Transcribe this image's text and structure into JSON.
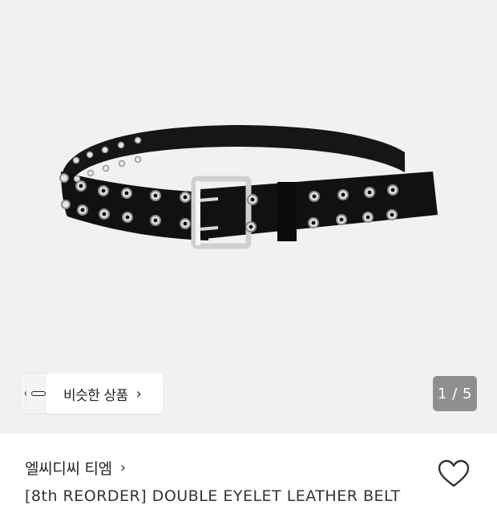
{
  "product_image": {
    "description_icon": "belt-image"
  },
  "similar": {
    "label": "비슷한 상품",
    "chevron": "›"
  },
  "pager": {
    "text": "1 / 5",
    "current": 1,
    "total": 5
  },
  "brand": {
    "name": "엘씨디씨 티엠",
    "chevron": "›"
  },
  "product": {
    "title": "[8th REORDER] DOUBLE EYELET LEATHER BELT"
  },
  "wishlist": {
    "icon": "heart-icon"
  },
  "colors": {
    "hero_bg": "#f1f1f1",
    "counter_bg": "#8f8f8f",
    "text": "#222222"
  }
}
